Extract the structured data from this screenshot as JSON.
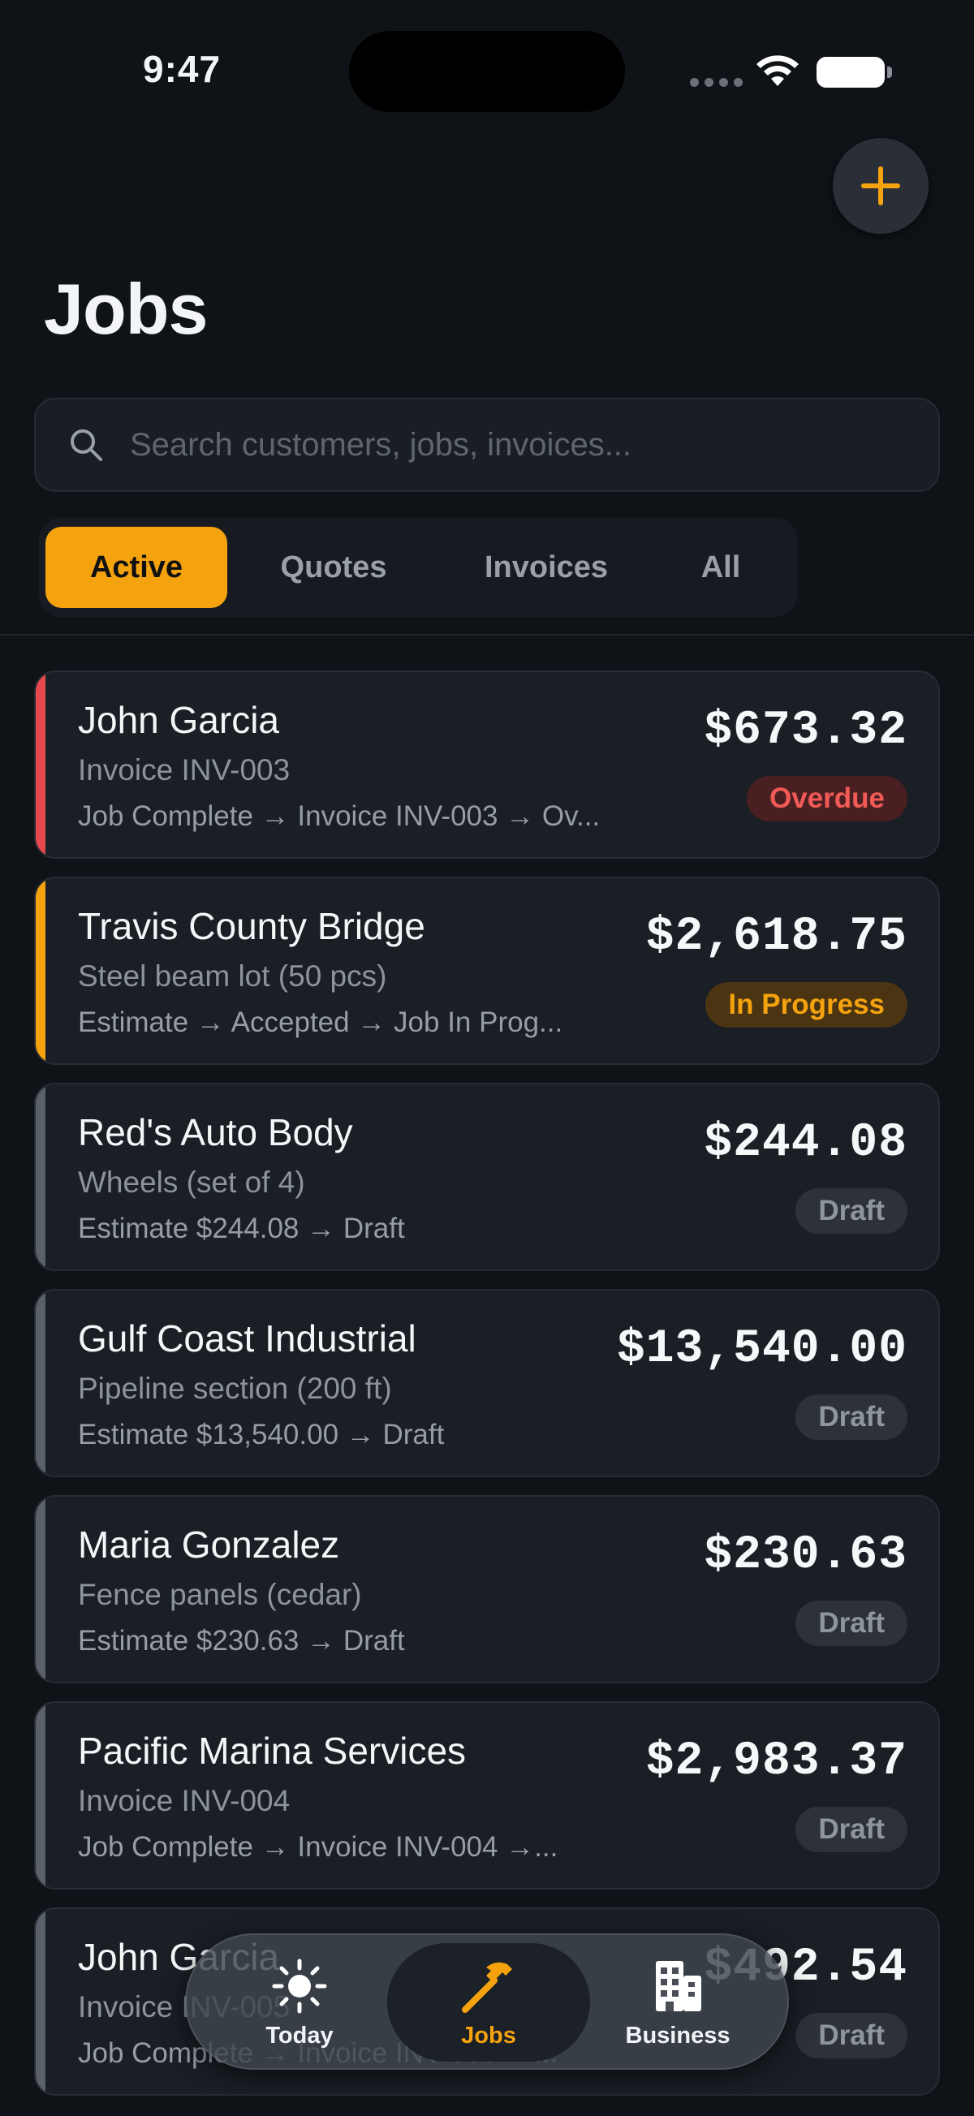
{
  "status_bar": {
    "time": "9:47"
  },
  "header": {
    "title": "Jobs",
    "add_icon": "plus-icon"
  },
  "search": {
    "placeholder": "Search customers, jobs, invoices..."
  },
  "tabs": [
    {
      "label": "Active",
      "active": true
    },
    {
      "label": "Quotes",
      "active": false
    },
    {
      "label": "Invoices",
      "active": false
    },
    {
      "label": "All",
      "active": false
    }
  ],
  "jobs": [
    {
      "name": "John Garcia",
      "detail": "Invoice INV-003",
      "flow": "Job Complete → Invoice INV-003 → Ov...",
      "amount": "$673.32",
      "status": "Overdue",
      "accent": "#e5484d"
    },
    {
      "name": "Travis County Bridge",
      "detail": "Steel beam lot (50 pcs)",
      "flow": "Estimate → Accepted → Job In Prog...",
      "amount": "$2,618.75",
      "status": "In Progress",
      "accent": "#f5a20f"
    },
    {
      "name": "Red's Auto Body",
      "detail": "Wheels (set of 4)",
      "flow": "Estimate $244.08 → Draft",
      "amount": "$244.08",
      "status": "Draft",
      "accent": "#5b616b"
    },
    {
      "name": "Gulf Coast Industrial",
      "detail": "Pipeline section (200 ft)",
      "flow": "Estimate $13,540.00 → Draft",
      "amount": "$13,540.00",
      "status": "Draft",
      "accent": "#5b616b"
    },
    {
      "name": "Maria Gonzalez",
      "detail": "Fence panels (cedar)",
      "flow": "Estimate $230.63 → Draft",
      "amount": "$230.63",
      "status": "Draft",
      "accent": "#5b616b"
    },
    {
      "name": "Pacific Marina Services",
      "detail": "Invoice INV-004",
      "flow": "Job Complete → Invoice INV-004 →...",
      "amount": "$2,983.37",
      "status": "Draft",
      "accent": "#5b616b"
    },
    {
      "name": "John Garcia",
      "detail": "Invoice INV-005",
      "flow": "Job Complete → Invoice INV-005 →...",
      "amount": "$492.54",
      "status": "Draft",
      "accent": "#5b616b"
    }
  ],
  "tab_bar": [
    {
      "label": "Today",
      "icon": "sun-icon",
      "active": false
    },
    {
      "label": "Jobs",
      "icon": "hammer-icon",
      "active": true
    },
    {
      "label": "Business",
      "icon": "building-icon",
      "active": false
    }
  ],
  "colors": {
    "accent": "#f5a20f",
    "overdue": "#e5484d",
    "background": "#0f1217",
    "card": "#1a1e25"
  }
}
